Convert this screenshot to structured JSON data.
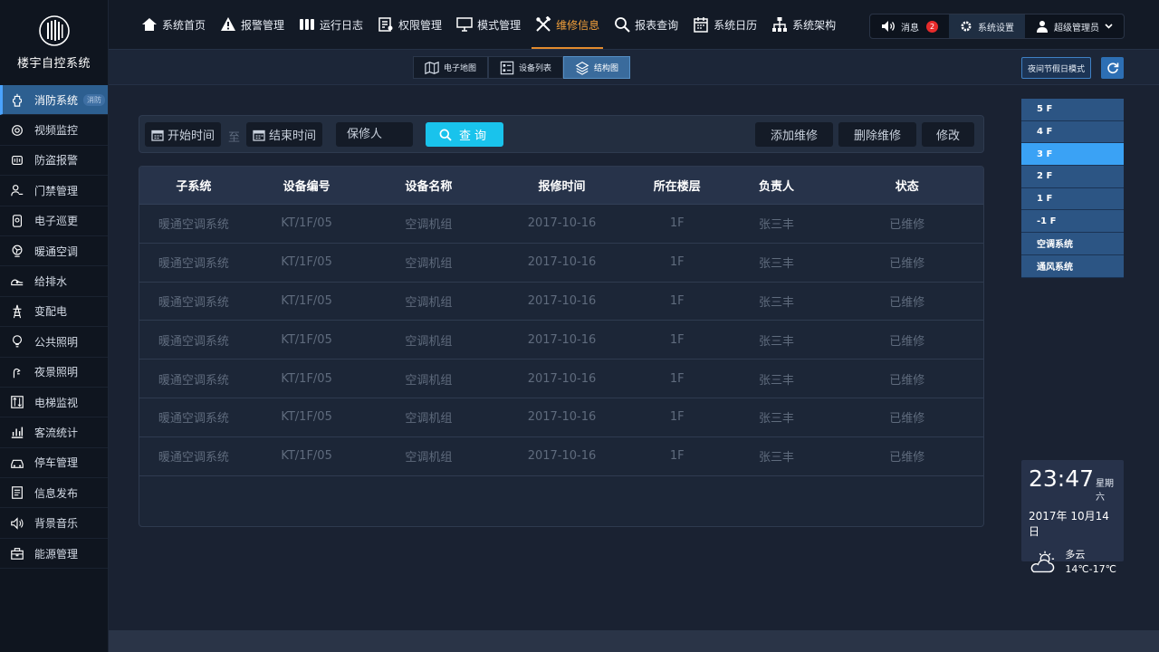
{
  "app": {
    "title": "楼宇自控系统"
  },
  "sidebar": {
    "items": [
      {
        "label": "消防系统",
        "icon": "fire-hydrant-icon",
        "badge": "消防"
      },
      {
        "label": "视频监控",
        "icon": "camera-icon"
      },
      {
        "label": "防盗报警",
        "icon": "alarm-icon"
      },
      {
        "label": "门禁管理",
        "icon": "access-control-icon"
      },
      {
        "label": "电子巡更",
        "icon": "patrol-icon"
      },
      {
        "label": "暖通空调",
        "icon": "hvac-icon"
      },
      {
        "label": "给排水",
        "icon": "water-supply-icon"
      },
      {
        "label": "变配电",
        "icon": "power-tower-icon"
      },
      {
        "label": "公共照明",
        "icon": "bulb-icon"
      },
      {
        "label": "夜景照明",
        "icon": "night-light-icon"
      },
      {
        "label": "电梯监视",
        "icon": "elevator-icon"
      },
      {
        "label": "客流统计",
        "icon": "chart-icon"
      },
      {
        "label": "停车管理",
        "icon": "car-icon"
      },
      {
        "label": "信息发布",
        "icon": "document-icon"
      },
      {
        "label": "背景音乐",
        "icon": "speaker-icon"
      },
      {
        "label": "能源管理",
        "icon": "toolbox-icon"
      }
    ]
  },
  "topnav": {
    "items": [
      {
        "label": "系统首页",
        "icon": "home-icon"
      },
      {
        "label": "报警管理",
        "icon": "warning-icon"
      },
      {
        "label": "运行日志",
        "icon": "log-icon"
      },
      {
        "label": "权限管理",
        "icon": "permission-icon"
      },
      {
        "label": "模式管理",
        "icon": "monitor-icon"
      },
      {
        "label": "维修信息",
        "icon": "tools-icon"
      },
      {
        "label": "报表查询",
        "icon": "search-icon"
      },
      {
        "label": "系统日历",
        "icon": "calendar-icon"
      },
      {
        "label": "系统架构",
        "icon": "hierarchy-icon"
      }
    ],
    "active_index": 5
  },
  "topright": {
    "messages_label": "消息",
    "messages_count": "2",
    "settings_label": "系统设置",
    "user_label": "超级管理员"
  },
  "subtabs": {
    "items": [
      {
        "label": "电子地图",
        "icon": "map-icon"
      },
      {
        "label": "设备列表",
        "icon": "list-icon"
      },
      {
        "label": "结构图",
        "icon": "layers-icon"
      }
    ],
    "active_index": 2
  },
  "mode_button": "夜间节假日模式",
  "filter": {
    "start_label": "开始时间",
    "separator": "至",
    "end_label": "结束时间",
    "person_placeholder": "保修人",
    "query_label": "查询",
    "add_label": "添加维修",
    "delete_label": "删除维修",
    "edit_label": "修改"
  },
  "table": {
    "columns": [
      "子系统",
      "设备编号",
      "设备名称",
      "报修时间",
      "所在楼层",
      "负责人",
      "状态"
    ],
    "rows": [
      [
        "暖通空调系统",
        "KT/1F/05",
        "空调机组",
        "2017-10-16",
        "1F",
        "张三丰",
        "已维修"
      ],
      [
        "暖通空调系统",
        "KT/1F/05",
        "空调机组",
        "2017-10-16",
        "1F",
        "张三丰",
        "已维修"
      ],
      [
        "暖通空调系统",
        "KT/1F/05",
        "空调机组",
        "2017-10-16",
        "1F",
        "张三丰",
        "已维修"
      ],
      [
        "暖通空调系统",
        "KT/1F/05",
        "空调机组",
        "2017-10-16",
        "1F",
        "张三丰",
        "已维修"
      ],
      [
        "暖通空调系统",
        "KT/1F/05",
        "空调机组",
        "2017-10-16",
        "1F",
        "张三丰",
        "已维修"
      ],
      [
        "暖通空调系统",
        "KT/1F/05",
        "空调机组",
        "2017-10-16",
        "1F",
        "张三丰",
        "已维修"
      ],
      [
        "暖通空调系统",
        "KT/1F/05",
        "空调机组",
        "2017-10-16",
        "1F",
        "张三丰",
        "已维修"
      ]
    ]
  },
  "floors": {
    "items": [
      "5 F",
      "4 F",
      "3 F",
      "2 F",
      "1 F",
      "-1 F",
      "空调系统",
      "通风系统"
    ],
    "active_index": 2
  },
  "clock": {
    "time": "23:47",
    "weekday": "星期六",
    "date": "2017年 10月14日",
    "weather": "多云",
    "temp": "14℃-17℃"
  }
}
